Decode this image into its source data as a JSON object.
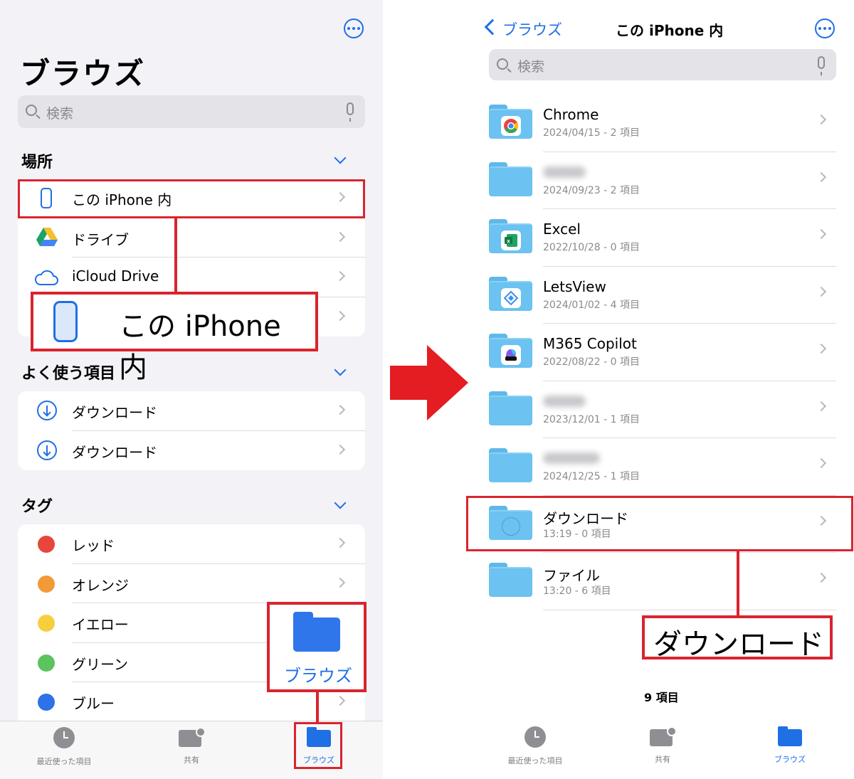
{
  "left": {
    "title": "ブラウズ",
    "search_placeholder": "検索",
    "locations": {
      "header": "場所",
      "items": [
        {
          "label": "この iPhone 内",
          "icon": "iphone-icon"
        },
        {
          "label": "ドライブ",
          "icon": "google-drive-icon"
        },
        {
          "label": "iCloud Drive",
          "icon": "icloud-icon"
        },
        {
          "label": "",
          "icon": ""
        }
      ]
    },
    "favorites": {
      "header": "よく使う項目",
      "items": [
        {
          "label": "ダウンロード",
          "icon": "download-icon"
        },
        {
          "label": "ダウンロード",
          "icon": "download-icon"
        }
      ]
    },
    "tags": {
      "header": "タグ",
      "items": [
        {
          "label": "レッド",
          "color": "#e8453c"
        },
        {
          "label": "オレンジ",
          "color": "#f29a38"
        },
        {
          "label": "イエロー",
          "color": "#f7cf3e"
        },
        {
          "label": "グリーン",
          "color": "#5cc35f"
        },
        {
          "label": "ブルー",
          "color": "#2d72e8"
        }
      ]
    },
    "tabs": [
      {
        "label": "最近使った項目",
        "icon": "clock-icon"
      },
      {
        "label": "共有",
        "icon": "shared-folder-icon"
      },
      {
        "label": "ブラウズ",
        "icon": "folder-icon"
      }
    ],
    "callout_iphone": "この iPhone 内",
    "callout_browse": "ブラウズ"
  },
  "right": {
    "back_label": "ブラウズ",
    "title": "この iPhone 内",
    "search_placeholder": "検索",
    "folders": [
      {
        "name": "Chrome",
        "meta": "2024/04/15 - 2 項目",
        "badge": "chrome-icon"
      },
      {
        "name": "",
        "meta": "2024/09/23 - 2 項目",
        "badge": ""
      },
      {
        "name": "Excel",
        "meta": "2022/10/28 - 0 項目",
        "badge": "excel-icon"
      },
      {
        "name": "LetsView",
        "meta": "2024/01/02 - 4 項目",
        "badge": "letsview-icon"
      },
      {
        "name": "M365 Copilot",
        "meta": "2022/08/22 - 0 項目",
        "badge": "m365-icon"
      },
      {
        "name": "",
        "meta": "2023/12/01 - 1 項目",
        "badge": ""
      },
      {
        "name": "",
        "meta": "2024/12/25 - 1 項目",
        "badge": ""
      },
      {
        "name": "ダウンロード",
        "meta": "13:19 - 0 項目",
        "badge": "download-icon"
      },
      {
        "name": "ファイル",
        "meta": "13:20 - 6 項目",
        "badge": ""
      }
    ],
    "item_count": "9 項目",
    "tabs": [
      {
        "label": "最近使った項目",
        "icon": "clock-icon"
      },
      {
        "label": "共有",
        "icon": "shared-folder-icon"
      },
      {
        "label": "ブラウズ",
        "icon": "folder-icon"
      }
    ],
    "callout_download": "ダウンロード"
  },
  "colors": {
    "accent": "#1f6fe5",
    "annotation_red": "#d9242e",
    "folder": "#6cc2f0"
  }
}
